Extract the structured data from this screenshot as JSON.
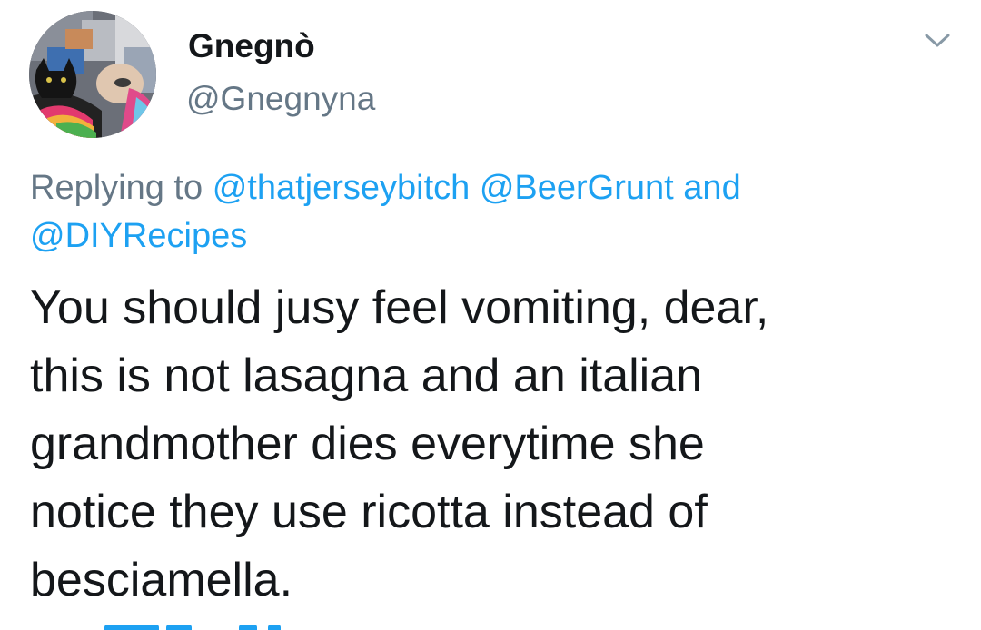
{
  "tweet": {
    "display_name": "Gnegnò",
    "handle": "@Gnegnyna",
    "reply_prefix": "Replying to",
    "reply_mentions": [
      "@thatjerseybitch",
      "@BeerGrunt",
      "@DIYRecipes"
    ],
    "reply_conjunction": "and",
    "text": "You should jusy feel vomiting, dear,\nthis is not lasagna and an italian\ngrandmother dies everytime she\nnotice they use ricotta instead of\nbesciamella."
  },
  "colors": {
    "link": "#1da1f2",
    "secondary_text": "#657786",
    "primary_text": "#14171a",
    "background": "#ffffff"
  },
  "icons": {
    "avatar": "avatar-image",
    "menu": "chevron-down-icon"
  }
}
